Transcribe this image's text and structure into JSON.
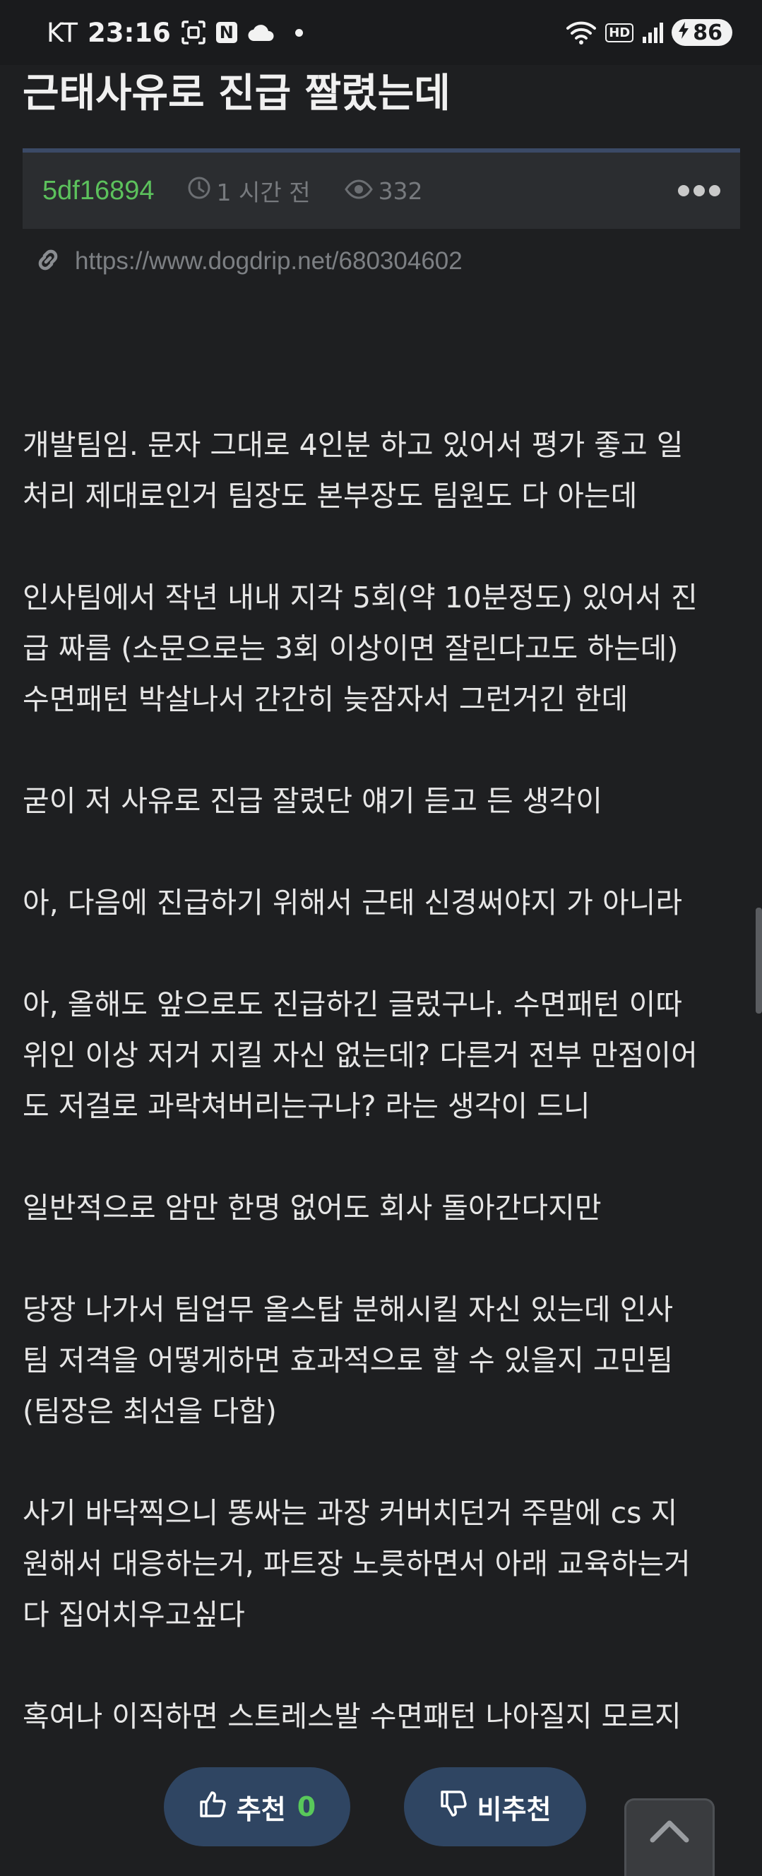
{
  "status_bar": {
    "carrier": "KT",
    "time": "23:16",
    "n_badge": "N",
    "hd": "HD",
    "battery": "86"
  },
  "post": {
    "title": "근태사유로 진급 짤렸는데",
    "author": "5df16894",
    "time_ago": "1 시간 전",
    "views": "332",
    "url": "https://www.dogdrip.net/680304602",
    "paragraphs": [
      [
        "개발팀임. 문자 그대로 4인분 하고 있어서 평가 좋고 일",
        "처리 제대로인거 팀장도 본부장도 팀원도 다 아는데"
      ],
      [
        "인사팀에서 작년 내내 지각 5회(약 10분정도) 있어서 진",
        "급 짜름 (소문으로는 3회 이상이면 잘린다고도 하는데)",
        "수면패턴 박살나서 간간히 늦잠자서 그런거긴 한데"
      ],
      [
        "굳이 저 사유로 진급 잘렸단 얘기 듣고 든 생각이"
      ],
      [
        "아, 다음에 진급하기 위해서 근태 신경써야지 가 아니라"
      ],
      [
        "아, 올해도 앞으로도 진급하긴 글렀구나. 수면패턴 이따",
        "위인 이상 저거 지킬 자신 없는데? 다른거 전부 만점이어",
        "도 저걸로 과락쳐버리는구나? 라는 생각이 드니"
      ],
      [
        "일반적으로 암만 한명 없어도 회사 돌아간다지만"
      ],
      [
        "당장 나가서 팀업무 올스탑 분해시킬 자신 있는데 인사",
        "팀 저격을 어떻게하면 효과적으로 할 수 있을지 고민됨",
        "(팀장은 최선을 다함)"
      ],
      [
        "사기 바닥찍으니 똥싸는 과장 커버치던거 주말에 cs 지",
        "원해서 대응하는거, 파트장 노릇하면서 아래 교육하는거",
        "다 집어치우고싶다"
      ],
      [
        "혹여나 이직하면 스트레스발 수면패턴 나아질지 모르지"
      ]
    ]
  },
  "actions": {
    "upvote_label": "추천",
    "upvote_count": "0",
    "downvote_label": "비추천"
  },
  "colors": {
    "background": "#1e1f21",
    "author": "#5cc15c",
    "vote_button": "#2f4562",
    "vote_count": "#59c95a"
  },
  "icons": [
    "qr-scan-icon",
    "naver-n-icon",
    "cloud-icon",
    "wifi-icon",
    "signal-icon",
    "battery-icon",
    "clock-icon",
    "eye-icon",
    "more-icon",
    "link-icon",
    "thumbs-up-icon",
    "thumbs-down-icon",
    "chevron-up-icon"
  ]
}
